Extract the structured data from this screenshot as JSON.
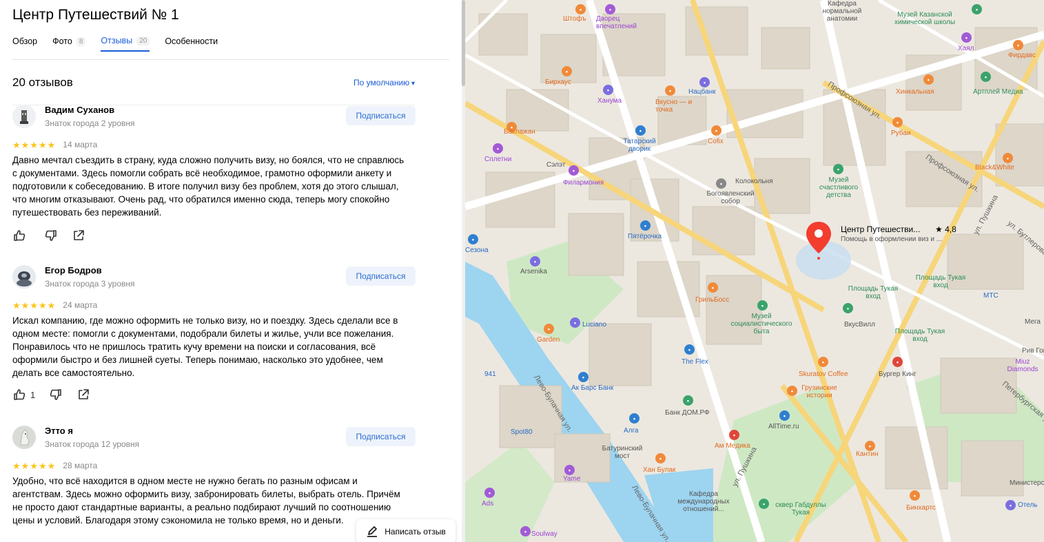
{
  "org": {
    "title": "Центр Путешествий № 1"
  },
  "tabs": [
    {
      "label": "Обзор",
      "count": ""
    },
    {
      "label": "Фото",
      "count": "8"
    },
    {
      "label": "Отзывы",
      "count": "20"
    },
    {
      "label": "Особенности",
      "count": ""
    }
  ],
  "reviews_header": {
    "count_label": "20 отзывов",
    "sort_label": "По умолчанию"
  },
  "reviews": [
    {
      "name": "Вадим Суханов",
      "level": "Знаток города 2 уровня",
      "subscribe_label": "Подписаться",
      "rating": 5,
      "date": "14 марта",
      "text": "Давно мечтал съездить в страну, куда сложно получить визу, но боялся, что не справлюсь с документами. Здесь помогли собрать всё необходимое, грамотно оформили анкету и подготовили к собеседованию. В итоге получил визу без проблем, хотя до этого слышал, что многим отказывают. Очень рад, что обратился именно сюда, теперь могу спокойно путешествовать без переживаний.",
      "likes": ""
    },
    {
      "name": "Егор Бодров",
      "level": "Знаток города 3 уровня",
      "subscribe_label": "Подписаться",
      "rating": 5,
      "date": "24 марта",
      "text": "Искал компанию, где можно оформить не только визу, но и поездку. Здесь сделали все в одном месте: помогли с документами, подобрали билеты и жилье, учли все пожелания. Понравилось что не пришлось тратить кучу времени на поиски и согласования, всё оформили быстро и без лишней суеты. Теперь понимаю, насколько это удобнее, чем делать все самостоятельно.",
      "likes": "1"
    },
    {
      "name": "Этто я",
      "level": "Знаток города 12 уровня",
      "subscribe_label": "Подписаться",
      "rating": 5,
      "date": "28 марта",
      "text": "Удобно, что всё находится в одном месте не нужно бегать по разным офисам и агентствам. Здесь можно оформить визу, забронировать билеты, выбрать отель. Причём не просто дают стандартные варианты, а реально подбирают лучший по соотношению цены и условий. Благодаря этому сэкономила не только время, но и деньги.",
      "likes": ""
    }
  ],
  "write_review_label": "Написать отзыв",
  "map": {
    "pin": {
      "name": "Центр Путешестви...",
      "rating": "★ 4,8",
      "description": "Помощь в оформлении виз и ..."
    },
    "labels": [
      {
        "text": "Штофъ",
        "cls": "orange"
      },
      {
        "text": "Дворец впечатлений",
        "cls": "purple"
      },
      {
        "text": "Кафедра нормальной анатомии",
        "cls": ""
      },
      {
        "text": "Музей Казанской химической школы",
        "cls": "green"
      },
      {
        "text": "Хаял",
        "cls": "purple"
      },
      {
        "text": "Фирдавс",
        "cls": "orange"
      },
      {
        "text": "Бирхаус",
        "cls": "orange"
      },
      {
        "text": "Ханума",
        "cls": "purple"
      },
      {
        "text": "Вкусно — и точка",
        "cls": "orange"
      },
      {
        "text": "Нацбанк",
        "cls": "blue"
      },
      {
        "text": "Хинкальная",
        "cls": "orange"
      },
      {
        "text": "Артплей Медиа",
        "cls": "green"
      },
      {
        "text": "Баклажан",
        "cls": "orange"
      },
      {
        "text": "Татарский дворик",
        "cls": "blue"
      },
      {
        "text": "Cofix",
        "cls": "orange"
      },
      {
        "text": "Рубаи",
        "cls": "orange"
      },
      {
        "text": "Black&White",
        "cls": "orange"
      },
      {
        "text": "Сплетни",
        "cls": "purple"
      },
      {
        "text": "Сэлэт",
        "cls": ""
      },
      {
        "text": "Филармония",
        "cls": "purple"
      },
      {
        "text": "Колокольня",
        "cls": ""
      },
      {
        "text": "Музей счастливого детства",
        "cls": "green"
      },
      {
        "text": "Богоявленский собор",
        "cls": ""
      },
      {
        "text": "Пятёрочка",
        "cls": "blue"
      },
      {
        "text": "Сезона",
        "cls": "blue"
      },
      {
        "text": "Arsenika",
        "cls": ""
      },
      {
        "text": "Площадь Тукая вход",
        "cls": "green"
      },
      {
        "text": "Площадь Тукая вход",
        "cls": "green"
      },
      {
        "text": "МТС",
        "cls": "blue"
      },
      {
        "text": "ГрильБосс",
        "cls": "orange"
      },
      {
        "text": "Музей социалистического быта",
        "cls": "green"
      },
      {
        "text": "ВкусВилл",
        "cls": ""
      },
      {
        "text": "Площадь Тукая вход",
        "cls": "green"
      },
      {
        "text": "Luciano",
        "cls": "blue"
      },
      {
        "text": "Garden",
        "cls": "orange"
      },
      {
        "text": "The Flex",
        "cls": "blue"
      },
      {
        "text": "Skuratov Coffee",
        "cls": "orange"
      },
      {
        "text": "Бургер Кинг",
        "cls": ""
      },
      {
        "text": "Рив Гош",
        "cls": ""
      },
      {
        "text": "Miuz Diamonds",
        "cls": "purple"
      },
      {
        "text": "941",
        "cls": "blue"
      },
      {
        "text": "Ак Барс Банк",
        "cls": "blue"
      },
      {
        "text": "Грузинские истории",
        "cls": "orange"
      },
      {
        "text": "Банк ДОМ.РФ",
        "cls": ""
      },
      {
        "text": "AllTime.ru",
        "cls": ""
      },
      {
        "text": "Spot80",
        "cls": "blue"
      },
      {
        "text": "Алга",
        "cls": "blue"
      },
      {
        "text": "Батуринский мост",
        "cls": ""
      },
      {
        "text": "Ам Медика",
        "cls": "orange"
      },
      {
        "text": "Кантин",
        "cls": "orange"
      },
      {
        "text": "Хан Булак",
        "cls": "orange"
      },
      {
        "text": "Yame",
        "cls": "purple"
      },
      {
        "text": "Ads",
        "cls": "purple"
      },
      {
        "text": "Кафедра международных отношений...",
        "cls": ""
      },
      {
        "text": "сквер Габдуллы Тукая",
        "cls": "green"
      },
      {
        "text": "Бинхартс",
        "cls": "orange"
      },
      {
        "text": "Отель",
        "cls": "blue"
      },
      {
        "text": "Soulway",
        "cls": "purple"
      },
      {
        "text": "Мега",
        "cls": ""
      },
      {
        "text": "Министерство",
        "cls": ""
      },
      {
        "text": "Профсоюзная ул.",
        "cls": "street"
      },
      {
        "text": "ул. Пушкина",
        "cls": "street"
      },
      {
        "text": "ул. Бутлерова",
        "cls": "street"
      },
      {
        "text": "Лево-Булачная ул.",
        "cls": "street"
      },
      {
        "text": "Петербургская ул.",
        "cls": "street"
      }
    ]
  }
}
